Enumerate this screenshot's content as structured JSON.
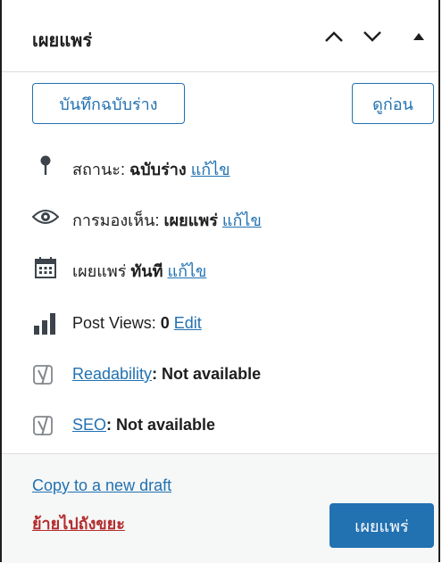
{
  "header": {
    "title": "เผยแพร่",
    "move_up_icon": "chevron-up-icon",
    "move_down_icon": "chevron-down-icon",
    "toggle_icon": "triangle-up-icon"
  },
  "actions": {
    "save_draft_label": "บันทึกฉบับร่าง",
    "preview_label": "ดูก่อน"
  },
  "status": {
    "label": "สถานะ:",
    "value": "ฉบับร่าง",
    "edit": "แก้ไข",
    "icon": "pin-icon"
  },
  "visibility": {
    "label": "การมองเห็น:",
    "value": "เผยแพร่",
    "edit": "แก้ไข",
    "icon": "eye-icon"
  },
  "schedule": {
    "label": "เผยแพร่",
    "value": "ทันที",
    "edit": "แก้ไข",
    "icon": "calendar-icon"
  },
  "post_views": {
    "label": "Post Views:",
    "value": "0",
    "edit": "Edit",
    "icon": "bar-chart-icon"
  },
  "readability": {
    "link": "Readability",
    "value": ": Not available",
    "icon": "yoast-icon"
  },
  "seo": {
    "link": "SEO",
    "value": ": Not available",
    "icon": "yoast-icon"
  },
  "footer": {
    "copy_draft": "Copy to a new draft",
    "trash": "ย้ายไปถังขยะ",
    "publish": "เผยแพร่"
  },
  "colors": {
    "accent": "#2271b1",
    "danger": "#b32d2e",
    "footer_bg": "#f6f7f7"
  }
}
